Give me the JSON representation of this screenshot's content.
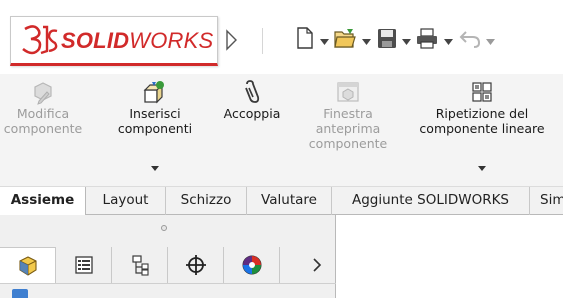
{
  "app": {
    "logo_prefix": "SOLID",
    "logo_suffix": "WORKS",
    "logo_icon": "3ds-logo-icon",
    "brand_color": "#d12a2a"
  },
  "quick_access": {
    "icons": [
      "menu-expand-arrow-icon",
      "new-document-icon",
      "open-folder-icon",
      "save-icon",
      "print-icon",
      "undo-icon"
    ]
  },
  "ribbon": {
    "buttons": [
      {
        "label": "Modifica\ncomponente",
        "icon": "edit-component-icon",
        "enabled": false
      },
      {
        "label": "Inserisci\ncomponenti",
        "icon": "insert-components-icon",
        "enabled": true
      },
      {
        "label": "Accoppia",
        "icon": "mate-paperclip-icon",
        "enabled": true
      },
      {
        "label": "Finestra\nanteprima\ncomponente",
        "icon": "component-preview-window-icon",
        "enabled": false
      },
      {
        "label": "Ripetizione del\ncomponente lineare",
        "icon": "linear-component-pattern-icon",
        "enabled": true
      }
    ]
  },
  "tabs": [
    {
      "label": "Assieme",
      "active": true
    },
    {
      "label": "Layout",
      "active": false
    },
    {
      "label": "Schizzo",
      "active": false
    },
    {
      "label": "Valutare",
      "active": false
    },
    {
      "label": "Aggiunte SOLIDWORKS",
      "active": false
    },
    {
      "label": "Sim",
      "active": false
    }
  ],
  "feature_manager": {
    "pane_tabs": [
      "feature-manager-tree-icon",
      "property-manager-icon",
      "configuration-manager-icon",
      "dimxpert-manager-icon",
      "display-manager-icon"
    ],
    "more_icon": "chevron-right-icon"
  },
  "colors": {
    "ribbon_bg": "#f4f4f4",
    "tab_bar_bg": "#f2f2f2",
    "disabled_text": "#9c9c9c",
    "tree_icon_blue": "#3f7fd0"
  }
}
